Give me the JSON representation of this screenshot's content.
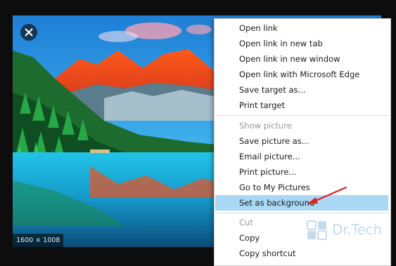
{
  "image_viewer": {
    "dimensions": "1600 × 1008",
    "close_icon": "close-icon"
  },
  "context_menu": {
    "group1": [
      "Open link",
      "Open link in new tab",
      "Open link in new window",
      "Open link with Microsoft Edge",
      "Save target as...",
      "Print target"
    ],
    "group2": [
      {
        "label": "Show picture",
        "disabled": true
      },
      {
        "label": "Save picture as...",
        "disabled": false
      },
      {
        "label": "Email picture...",
        "disabled": false
      },
      {
        "label": "Print picture...",
        "disabled": false
      },
      {
        "label": "Go to My Pictures",
        "disabled": false
      },
      {
        "label": "Set as background",
        "disabled": false,
        "highlighted": true
      }
    ],
    "group3": [
      {
        "label": "Cut",
        "disabled": true
      },
      {
        "label": "Copy",
        "disabled": false
      },
      {
        "label": "Copy shortcut",
        "disabled": false
      }
    ]
  },
  "annotation": {
    "arrow_color": "#e02020",
    "arrow_icon": "red-arrow-icon"
  },
  "watermark": {
    "text": "Dr.Tech",
    "color": "#7fb1d8"
  },
  "colors": {
    "highlight": "#a9d8f5",
    "disabled_text": "#9a9a9a"
  }
}
